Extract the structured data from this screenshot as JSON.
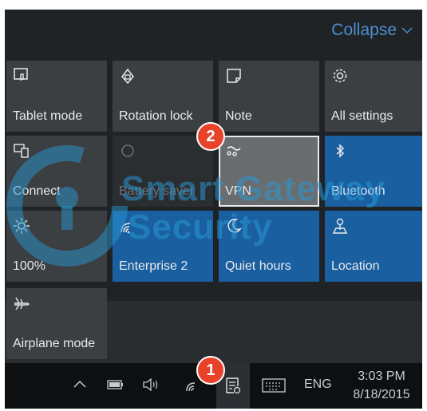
{
  "action_center": {
    "collapse_label": "Collapse",
    "tiles": [
      {
        "label": "Tablet mode",
        "icon": "tablet-mode-icon",
        "state": "off"
      },
      {
        "label": "Rotation lock",
        "icon": "rotation-lock-icon",
        "state": "off"
      },
      {
        "label": "Note",
        "icon": "note-icon",
        "state": "off"
      },
      {
        "label": "All settings",
        "icon": "gear-icon",
        "state": "off"
      },
      {
        "label": "Connect",
        "icon": "connect-icon",
        "state": "off"
      },
      {
        "label": "Battery saver",
        "icon": "battery-saver-icon",
        "state": "disabled"
      },
      {
        "label": "VPN",
        "icon": "vpn-icon",
        "state": "selected"
      },
      {
        "label": "Bluetooth",
        "icon": "bluetooth-icon",
        "state": "on"
      },
      {
        "label": "100%",
        "icon": "brightness-icon",
        "state": "off"
      },
      {
        "label": "Enterprise 2",
        "icon": "wifi-icon",
        "state": "on"
      },
      {
        "label": "Quiet hours",
        "icon": "moon-icon",
        "state": "on"
      },
      {
        "label": "Location",
        "icon": "location-icon",
        "state": "on"
      },
      {
        "label": "Airplane mode",
        "icon": "airplane-icon",
        "state": "off"
      }
    ]
  },
  "taskbar": {
    "language": "ENG",
    "time": "3:03 PM",
    "date": "8/18/2015"
  },
  "annotations": {
    "step1": "1",
    "step2": "2"
  },
  "watermark": {
    "line1": "Smart Gateway",
    "line2": "Security"
  },
  "colors": {
    "panel_bg": "#202325",
    "tile_off": "#3c3f42",
    "tile_on": "#1a5fa0",
    "accent_text": "#4a8fd0",
    "badge": "#e8432a"
  }
}
